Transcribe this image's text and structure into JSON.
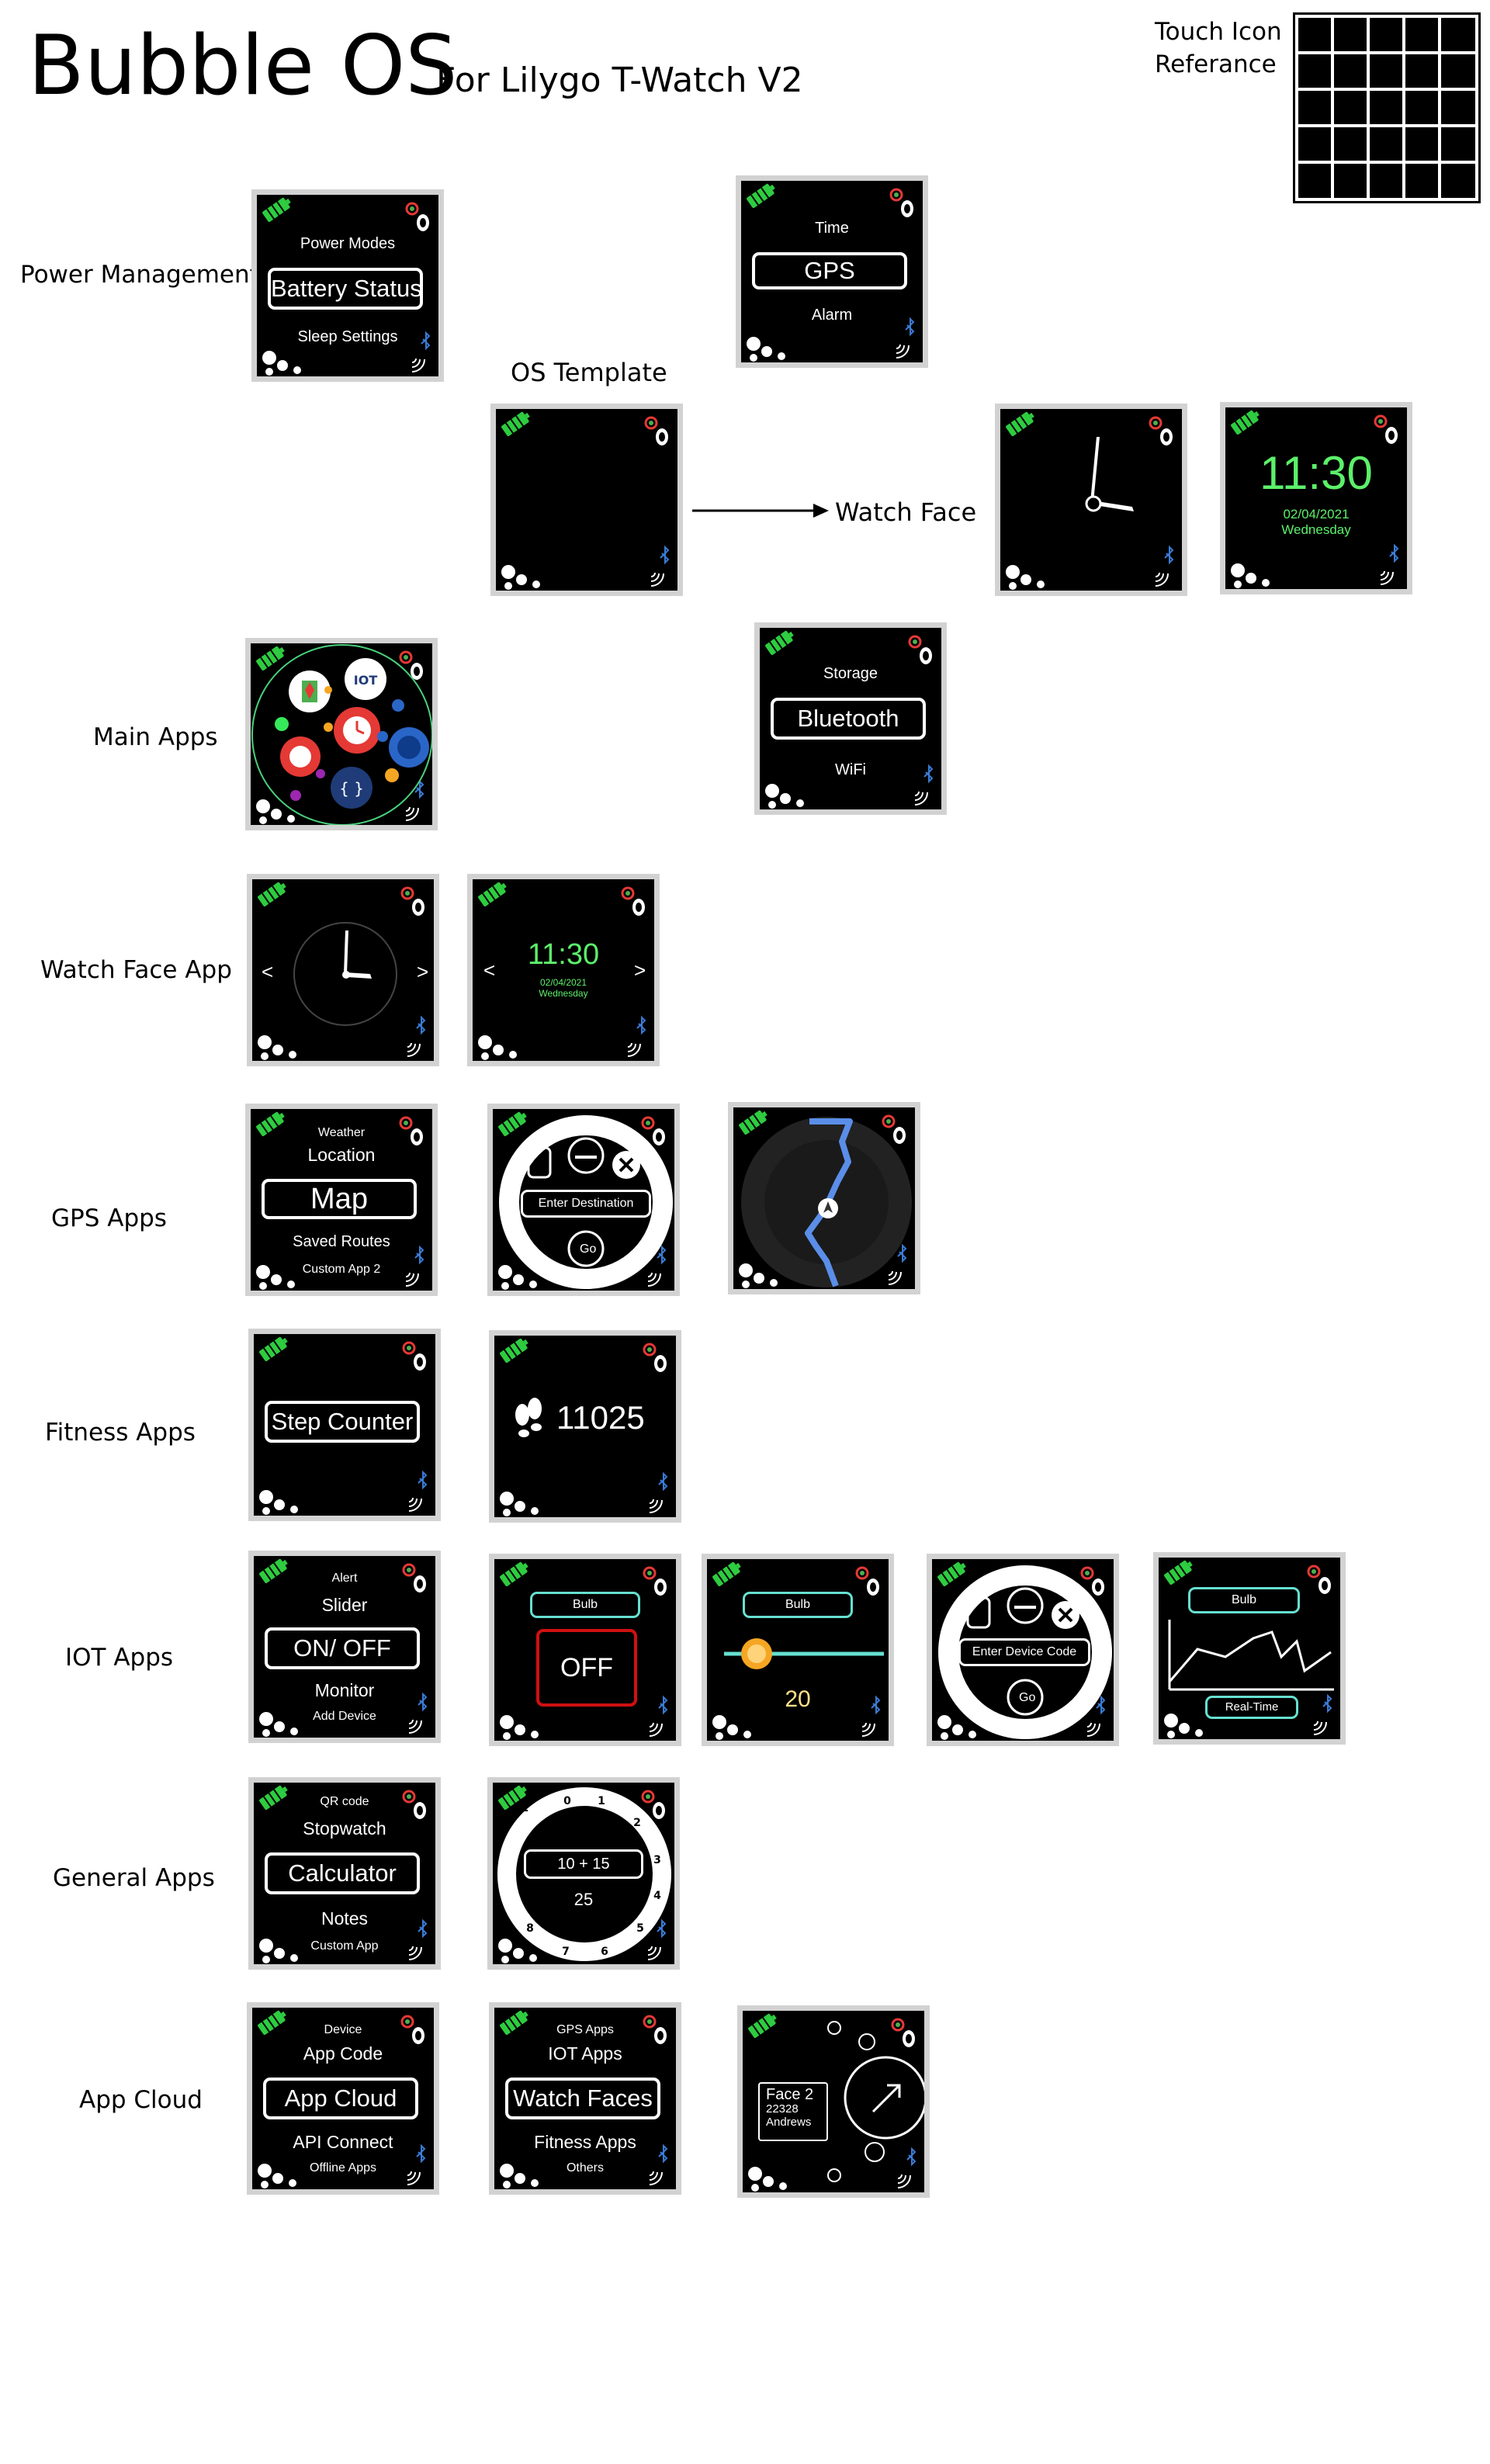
{
  "header": {
    "title": "Bubble OS",
    "subtitle": "For Lilygo T-Watch V2",
    "touch_ref_line1": "Touch Icon",
    "touch_ref_line2": "Referance"
  },
  "labels": {
    "os_template": "OS Template",
    "watch_face": "Watch Face"
  },
  "rows": [
    {
      "label": "Power Management"
    },
    {
      "label": "Main Apps"
    },
    {
      "label": "Watch Face App"
    },
    {
      "label": "GPS Apps"
    },
    {
      "label": "Fitness Apps"
    },
    {
      "label": "IOT Apps"
    },
    {
      "label": "General Apps"
    },
    {
      "label": "App Cloud"
    }
  ],
  "screens": {
    "power": {
      "top": "Power Modes",
      "selected": "Battery Status",
      "bottom": "Sleep Settings"
    },
    "time": {
      "top": "Time",
      "selected": "GPS",
      "bottom": "Alarm"
    },
    "digital_face": {
      "time": "11:30",
      "date": "02/04/2021",
      "day": "Wednesday"
    },
    "storage": {
      "top": "Storage",
      "selected": "Bluetooth",
      "bottom": "WiFi"
    },
    "face_app_digital": {
      "time": "11:30",
      "date": "02/04/2021",
      "day": "Wednesday",
      "prev": "<",
      "next": ">"
    },
    "face_app_analog": {
      "prev": "<",
      "next": ">"
    },
    "gps_menu": {
      "top2": "Weather",
      "top": "Location",
      "selected": "Map",
      "bottom": "Saved Routes",
      "bottom2": "Custom App 2"
    },
    "gps_entry": {
      "field": "Enter Destination",
      "go": "Go"
    },
    "fitness_menu": {
      "selected": "Step Counter"
    },
    "steps": {
      "count": "11025"
    },
    "iot_menu": {
      "top2": "Alert",
      "top": "Slider",
      "selected": "ON/ OFF",
      "bottom": "Monitor",
      "bottom2": "Add Device"
    },
    "iot_switch": {
      "device": "Bulb",
      "state": "OFF"
    },
    "iot_slider": {
      "device": "Bulb",
      "value": "20"
    },
    "iot_entry": {
      "field": "Enter Device Code",
      "go": "Go"
    },
    "iot_monitor": {
      "device": "Bulb",
      "mode": "Real-Time"
    },
    "general_menu": {
      "top2": "QR code",
      "top": "Stopwatch",
      "selected": "Calculator",
      "bottom": "Notes",
      "bottom2": "Custom App"
    },
    "calc": {
      "expr": "10 + 15",
      "result": "25"
    },
    "cloud_menu1": {
      "top2": "Device",
      "top": "App Code",
      "selected": "App Cloud",
      "bottom": "API Connect",
      "bottom2": "Offline Apps"
    },
    "cloud_menu2": {
      "top2": "GPS Apps",
      "top": "IOT Apps",
      "selected": "Watch Faces",
      "bottom": "Fitness Apps",
      "bottom2": "Others"
    },
    "face_store": {
      "name": "Face 2",
      "id": "22328",
      "author": "Andrews"
    }
  },
  "colors": {
    "battery": "#2ecc40",
    "digital_time": "#5cf06a",
    "teal": "#66e0d0",
    "red": "#d01010",
    "orange": "#f5a623",
    "route_blue": "#5a8ee8"
  }
}
